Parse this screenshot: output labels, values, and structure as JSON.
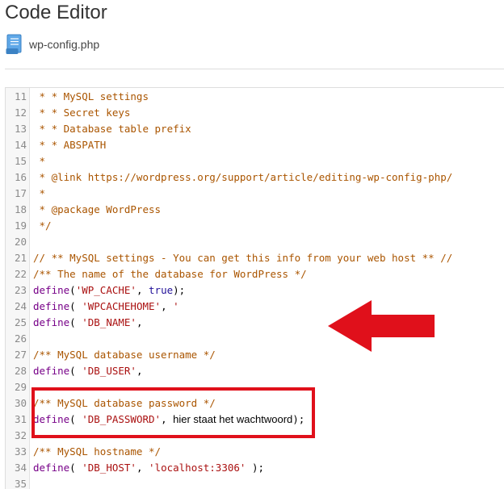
{
  "page": {
    "title": "Code Editor"
  },
  "file": {
    "name": "wp-config.php",
    "icon": "document-icon"
  },
  "colors": {
    "comment": "#aa5500",
    "keyword": "#770088",
    "string": "#aa1111",
    "atom": "#221199",
    "highlight": "#e0101b"
  },
  "editor": {
    "lines": [
      {
        "num": "11",
        "tokens": [
          {
            "t": " * * MySQL settings",
            "c": "comment"
          }
        ]
      },
      {
        "num": "12",
        "tokens": [
          {
            "t": " * * Secret keys",
            "c": "comment"
          }
        ]
      },
      {
        "num": "13",
        "tokens": [
          {
            "t": " * * Database table prefix",
            "c": "comment"
          }
        ]
      },
      {
        "num": "14",
        "tokens": [
          {
            "t": " * * ABSPATH",
            "c": "comment"
          }
        ]
      },
      {
        "num": "15",
        "tokens": [
          {
            "t": " *",
            "c": "comment"
          }
        ]
      },
      {
        "num": "16",
        "tokens": [
          {
            "t": " * @link https://wordpress.org/support/article/editing-wp-config-php/",
            "c": "comment"
          }
        ]
      },
      {
        "num": "17",
        "tokens": [
          {
            "t": " *",
            "c": "comment"
          }
        ]
      },
      {
        "num": "18",
        "tokens": [
          {
            "t": " * @package WordPress",
            "c": "comment"
          }
        ]
      },
      {
        "num": "19",
        "tokens": [
          {
            "t": " */",
            "c": "comment"
          }
        ]
      },
      {
        "num": "20",
        "tokens": []
      },
      {
        "num": "21",
        "tokens": [
          {
            "t": "// ** MySQL settings - You can get this info from your web host ** //",
            "c": "comment"
          }
        ]
      },
      {
        "num": "22",
        "tokens": [
          {
            "t": "/** The name of the database for WordPress */",
            "c": "comment"
          }
        ]
      },
      {
        "num": "23",
        "tokens": [
          {
            "t": "define",
            "c": "kw"
          },
          {
            "t": "(",
            "c": "plain"
          },
          {
            "t": "'WP_CACHE'",
            "c": "str"
          },
          {
            "t": ", ",
            "c": "plain"
          },
          {
            "t": "true",
            "c": "atom"
          },
          {
            "t": ");",
            "c": "plain"
          }
        ]
      },
      {
        "num": "24",
        "tokens": [
          {
            "t": "define",
            "c": "kw"
          },
          {
            "t": "( ",
            "c": "plain"
          },
          {
            "t": "'WPCACHEHOME'",
            "c": "str"
          },
          {
            "t": ", ",
            "c": "plain"
          },
          {
            "t": "'",
            "c": "str"
          }
        ]
      },
      {
        "num": "25",
        "tokens": [
          {
            "t": "define",
            "c": "kw"
          },
          {
            "t": "( ",
            "c": "plain"
          },
          {
            "t": "'DB_NAME'",
            "c": "str"
          },
          {
            "t": ",",
            "c": "plain"
          }
        ]
      },
      {
        "num": "26",
        "tokens": []
      },
      {
        "num": "27",
        "tokens": [
          {
            "t": "/** MySQL database username */",
            "c": "comment"
          }
        ]
      },
      {
        "num": "28",
        "tokens": [
          {
            "t": "define",
            "c": "kw"
          },
          {
            "t": "( ",
            "c": "plain"
          },
          {
            "t": "'DB_USER'",
            "c": "str"
          },
          {
            "t": ",",
            "c": "plain"
          }
        ]
      },
      {
        "num": "29",
        "tokens": []
      },
      {
        "num": "30",
        "tokens": [
          {
            "t": "/** MySQL database password */",
            "c": "comment"
          }
        ]
      },
      {
        "num": "31",
        "tokens": [
          {
            "t": "define",
            "c": "kw"
          },
          {
            "t": "( ",
            "c": "plain"
          },
          {
            "t": "'DB_PASSWORD'",
            "c": "str"
          },
          {
            "t": ", ",
            "c": "plain"
          },
          {
            "t": "hier staat het wachtwoord",
            "c": "note"
          },
          {
            "t": ");",
            "c": "plain"
          }
        ]
      },
      {
        "num": "32",
        "tokens": []
      },
      {
        "num": "33",
        "tokens": [
          {
            "t": "/** MySQL hostname */",
            "c": "comment"
          }
        ]
      },
      {
        "num": "34",
        "tokens": [
          {
            "t": "define",
            "c": "kw"
          },
          {
            "t": "( ",
            "c": "plain"
          },
          {
            "t": "'DB_HOST'",
            "c": "str"
          },
          {
            "t": ", ",
            "c": "plain"
          },
          {
            "t": "'localhost:3306'",
            "c": "str"
          },
          {
            "t": " );",
            "c": "plain"
          }
        ]
      },
      {
        "num": "35",
        "tokens": []
      }
    ]
  },
  "annotation": {
    "highlight_lines": [
      "30",
      "31",
      "32"
    ],
    "arrow_direction": "left"
  }
}
